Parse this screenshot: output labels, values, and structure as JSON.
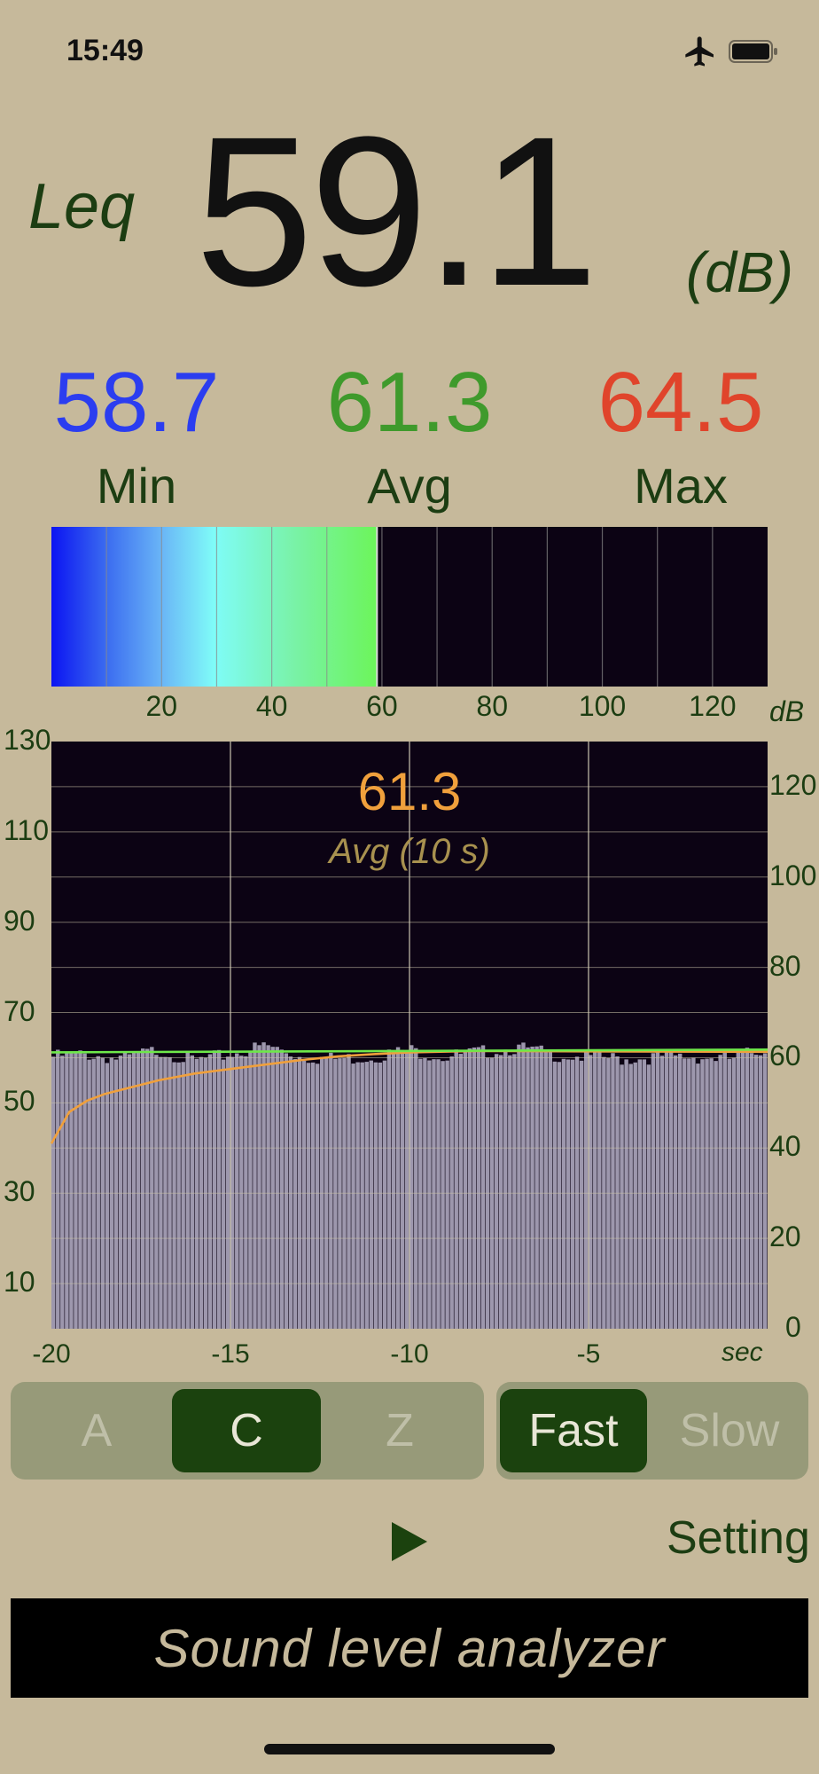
{
  "status_bar": {
    "time": "15:49",
    "airplane_icon": "airplane-icon",
    "battery_icon": "battery-icon"
  },
  "leq": {
    "label": "Leq",
    "value": "59.1",
    "unit": "(dB)"
  },
  "stats": {
    "min": {
      "value": "58.7",
      "label": "Min",
      "color": "#2b3df0"
    },
    "avg": {
      "value": "61.3",
      "label": "Avg",
      "color": "#3f9a2c"
    },
    "max": {
      "value": "64.5",
      "label": "Max",
      "color": "#e0442b"
    }
  },
  "level_meter": {
    "current_db": 59.1,
    "range": [
      0,
      130
    ],
    "ticks": [
      "20",
      "40",
      "60",
      "80",
      "100",
      "120"
    ],
    "unit": "dB"
  },
  "chart_data": {
    "type": "bar",
    "x_range": [
      -20,
      0
    ],
    "y_left_range": [
      0,
      130
    ],
    "y_right_range": [
      0,
      130
    ],
    "x_ticks": [
      "-20",
      "-15",
      "-10",
      "-5"
    ],
    "x_unit": "sec",
    "y_left_ticks": [
      "130",
      "110",
      "90",
      "70",
      "50",
      "30",
      "10"
    ],
    "y_right_ticks": [
      "120",
      "100",
      "80",
      "60",
      "40",
      "20",
      "0"
    ],
    "overlay_value": "61.3",
    "overlay_label": "Avg (10 s)",
    "grid": true,
    "series": [
      {
        "type": "bar",
        "x": [
          -20,
          -19,
          -18,
          -17,
          -16,
          -15,
          -14,
          -13,
          -12,
          -11,
          -10,
          -9,
          -8,
          -7,
          -6,
          -5,
          -4,
          -3,
          -2,
          -1,
          0
        ],
        "values": [
          61.0,
          61.5,
          60.5,
          62.5,
          60.0,
          61.5,
          63.5,
          61.0,
          60.5,
          61.0,
          62.5,
          61.0,
          62.0,
          63.0,
          61.5,
          61.0,
          60.5,
          61.0,
          61.0,
          60.5,
          63.0
        ]
      },
      {
        "name": "Avg",
        "type": "line",
        "color": "#f0a03c",
        "x": [
          -20,
          -19.5,
          -19,
          -18.5,
          -18,
          -17.5,
          -17,
          -16,
          -15,
          -14,
          -13,
          -12,
          -11,
          -10,
          -8,
          -5,
          0
        ],
        "values": [
          41,
          48,
          50.5,
          52,
          53,
          54,
          55,
          56.5,
          57.5,
          58.5,
          59.5,
          60.3,
          60.8,
          61.2,
          61.5,
          61.4,
          61.3
        ]
      },
      {
        "type": "line",
        "color": "#6ee84a",
        "x": [
          -20,
          0
        ],
        "values": [
          61.2,
          61.8
        ]
      }
    ]
  },
  "weighting": {
    "options": [
      "A",
      "C",
      "Z"
    ],
    "selected": "C"
  },
  "response": {
    "options": [
      "Fast",
      "Slow"
    ],
    "selected": "Fast"
  },
  "controls": {
    "play_icon": "play-icon",
    "setting_label": "Setting"
  },
  "banner": {
    "text": "Sound level analyzer"
  }
}
